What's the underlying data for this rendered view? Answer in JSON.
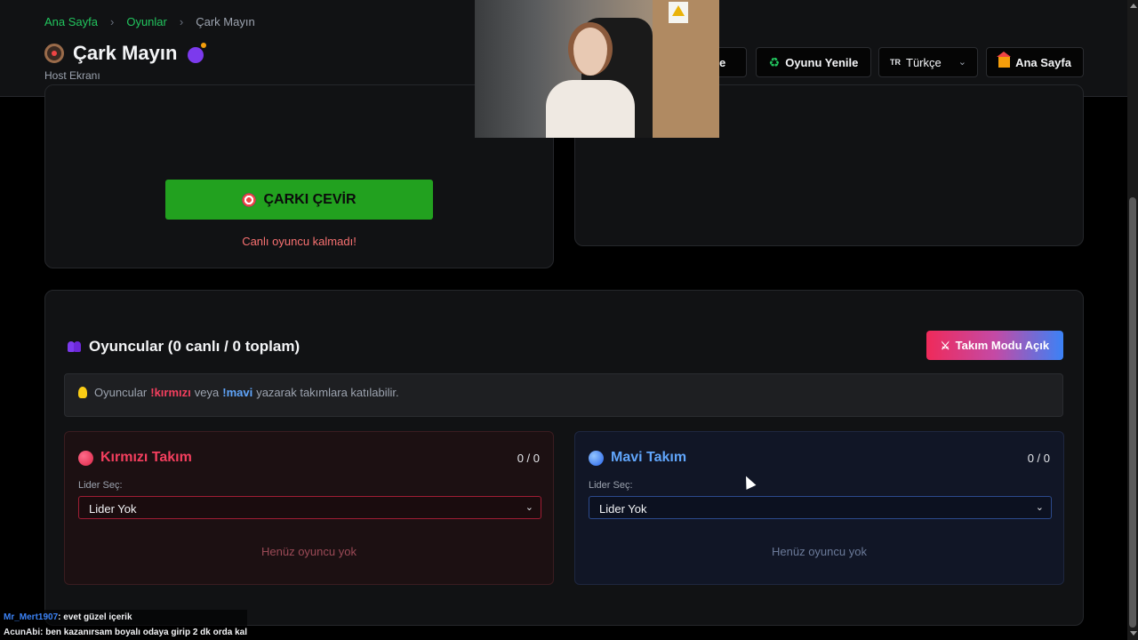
{
  "breadcrumb": {
    "home": "Ana Sayfa",
    "games": "Oyunlar",
    "current": "Çark Mayın",
    "separator": "›"
  },
  "header": {
    "title": "Çark Mayın",
    "subtitle": "Host Ekranı",
    "partial_button_label": "nile",
    "refresh_game_label": "Oyunu Yenile",
    "language": {
      "flag": "TR",
      "selected": "Türkçe"
    },
    "home_button_label": "Ana Sayfa"
  },
  "wheel": {
    "spin_button_label": "ÇARKI ÇEVİR",
    "status_message": "Canlı oyuncu kalmadı!"
  },
  "players": {
    "title": "Oyuncular (0 canlı / 0 toplam)",
    "team_mode_button_label": "Takım Modu Açık",
    "info": {
      "before": "Oyuncular",
      "red_cmd": "!kırmızı",
      "middle": "veya",
      "blue_cmd": "!mavi",
      "after": "yazarak takımlara katılabilir."
    },
    "teams": [
      {
        "name": "Kırmızı Takım",
        "count": "0 / 0",
        "leader_label": "Lider Seç:",
        "leader_value": "Lider Yok",
        "empty_text": "Henüz oyuncu yok"
      },
      {
        "name": "Mavi Takım",
        "count": "0 / 0",
        "leader_label": "Lider Seç:",
        "leader_value": "Lider Yok",
        "empty_text": "Henüz oyuncu yok"
      }
    ]
  },
  "chat": [
    {
      "user": "Mr_Mert1907",
      "message": ": evet güzel içerik"
    },
    {
      "user": "AcunAbi",
      "message": ": ben kazanırsam boyalı odaya girip 2 dk orda kal"
    }
  ],
  "colors": {
    "accent_green": "#22a11f",
    "red_team": "#f43f5e",
    "blue_team": "#60a5fa",
    "background": "#000000"
  },
  "icons": [
    "wheel-icon",
    "bomb-icon",
    "recycle-icon",
    "house-icon",
    "target-icon",
    "people-icon",
    "bulb-icon",
    "swords-icon",
    "chevron-down-icon"
  ]
}
